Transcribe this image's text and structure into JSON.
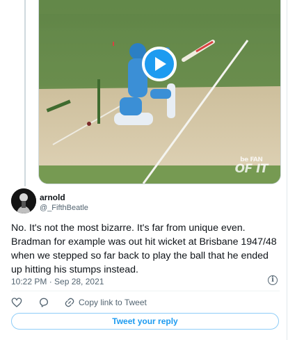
{
  "media": {
    "watermark_line1": "be FAN",
    "watermark_line2": "OF IT"
  },
  "author": {
    "name": "arnold",
    "handle": "@_FifthBeatle"
  },
  "tweet": {
    "text": "No. It's not the most bizarre. It's far from unique even. Bradman for example was out hit wicket at Brisbane 1947/48 when we stepped so far back to play the ball that he ended up hitting his stumps instead.",
    "timestamp": "10:22 PM · Sep 28, 2021"
  },
  "actions": {
    "reply_icon": "reply-icon",
    "like_icon": "heart-icon",
    "comment_icon": "comment-icon",
    "share_icon": "link-icon",
    "copy_link_label": "Copy link to Tweet"
  },
  "reply_button": {
    "label": "Tweet your reply"
  },
  "colors": {
    "accent": "#1d9bf0",
    "secondary_text": "#536471",
    "pitch": "#d8cdb0",
    "outfield": "#6f8d4f"
  }
}
